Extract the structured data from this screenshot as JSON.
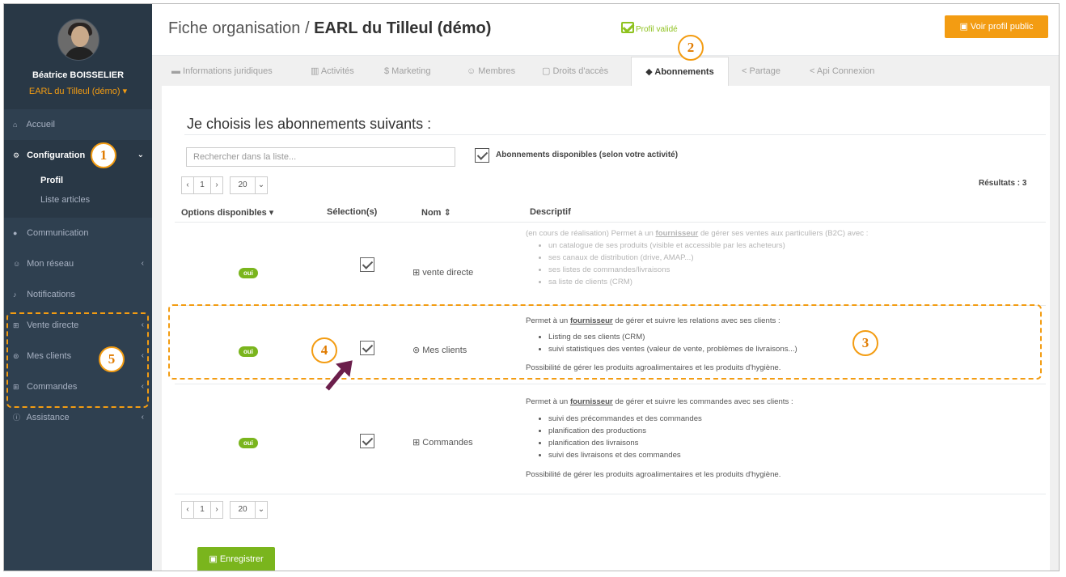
{
  "user": {
    "name": "Béatrice BOISSELIER",
    "organization": "EARL du Tilleul (démo) ▾"
  },
  "sidebar": {
    "items": [
      {
        "icon": "home-icon",
        "glyph": "⌂",
        "label": "Accueil"
      },
      {
        "icon": "cogs-icon",
        "glyph": "⚙",
        "label": "Configuration",
        "chevron": "⌄"
      },
      {
        "icon": "comments-icon",
        "glyph": "●",
        "label": "Communication"
      },
      {
        "icon": "users-icon",
        "glyph": "☺",
        "label": "Mon réseau",
        "chevron": "‹"
      },
      {
        "icon": "bell-icon",
        "glyph": "♪",
        "label": "Notifications"
      },
      {
        "icon": "cart-icon",
        "glyph": "⊞",
        "label": "Vente directe",
        "chevron": "‹"
      },
      {
        "icon": "handshake-icon",
        "glyph": "⊚",
        "label": "Mes clients",
        "chevron": "‹"
      },
      {
        "icon": "cart-icon",
        "glyph": "⊞",
        "label": "Commandes",
        "chevron": "‹"
      },
      {
        "icon": "info-icon",
        "glyph": "ⓘ",
        "label": "Assistance",
        "chevron": "‹"
      }
    ],
    "submenu": [
      "Profil",
      "Liste articles"
    ]
  },
  "header": {
    "title_prefix": "Fiche organisation / ",
    "title_bold": "EARL du Tilleul (démo)",
    "status": "Profil validé",
    "public_button": "▣ Voir profil public"
  },
  "tabs": [
    {
      "icon": "folder-icon",
      "label": "▬  Informations juridiques"
    },
    {
      "icon": "chart-icon",
      "label": "▥  Activités"
    },
    {
      "icon": "dollar-icon",
      "label": "$  Marketing"
    },
    {
      "icon": "users-icon",
      "label": "☺  Membres"
    },
    {
      "icon": "lock-icon",
      "label": "▢  Droits d'accès"
    },
    {
      "icon": "tag-icon",
      "label": "◆  Abonnements"
    },
    {
      "icon": "share-icon",
      "label": "<  Partage"
    },
    {
      "icon": "share-icon",
      "label": "<  Api Connexion"
    }
  ],
  "content": {
    "heading": "Je choisis les abonnements suivants :",
    "search_placeholder": "Rechercher dans la liste...",
    "available_label": "Abonnements disponibles (selon votre activité)",
    "results": "Résultats : 3",
    "pager": {
      "prev": "‹",
      "page": "1",
      "next": "›",
      "size": "20",
      "size_chevron": "⌄"
    },
    "columns": [
      "Options disponibles ▾",
      "Sélection(s)",
      "Nom ⇕",
      "Descriptif"
    ],
    "save_button": "▣ Enregistrer"
  },
  "rows": [
    {
      "badge": "oui",
      "name": "⊞ vente directe",
      "desc_intro_pre": "(en cours de réalisation) Permet à un ",
      "desc_intro_bold": "fournisseur",
      "desc_intro_post": " de gérer ses ventes aux particuliers (B2C) avec :",
      "bullets": [
        "un catalogue de ses produits (visible et accessible par les acheteurs)",
        "ses canaux de distribution (drive, AMAP...)",
        "ses listes de commandes/livraisons",
        "sa liste de clients (CRM)"
      ],
      "footer": ""
    },
    {
      "badge": "oui",
      "name": "⊚ Mes clients",
      "desc_intro_pre": "Permet à un ",
      "desc_intro_bold": "fournisseur",
      "desc_intro_post": " de gérer et suivre les relations avec ses clients :",
      "bullets": [
        "Listing de ses clients (CRM)",
        "suivi statistiques des ventes (valeur de vente, problèmes de livraisons...)"
      ],
      "footer": "Possibilité de gérer les produits agroalimentaires et les produits d'hygiène."
    },
    {
      "badge": "oui",
      "name": "⊞ Commandes",
      "desc_intro_pre": "Permet à un ",
      "desc_intro_bold": "fournisseur",
      "desc_intro_post": " de gérer et suivre les commandes avec ses clients :",
      "bullets": [
        "suivi des précommandes et des commandes",
        "planification des productions",
        "planification des livraisons",
        "suivi des livraisons et des commandes"
      ],
      "footer": "Possibilité de gérer les produits agroalimentaires et les produits d'hygiène."
    }
  ],
  "annotations": [
    "1",
    "2",
    "3",
    "4",
    "5"
  ],
  "colors": {
    "sidebar": "#2f4050",
    "accent": "#f39c12",
    "green": "#7ab51d"
  }
}
